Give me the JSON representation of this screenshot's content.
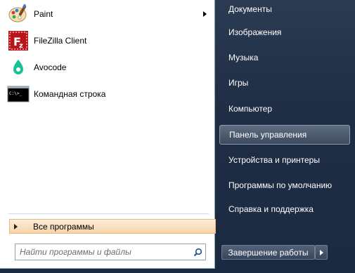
{
  "programs": [
    {
      "label": "Paint",
      "icon": "paint-palette-icon",
      "has_submenu": true
    },
    {
      "label": "FileZilla Client",
      "icon": "filezilla-icon",
      "has_submenu": false
    },
    {
      "label": "Avocode",
      "icon": "avocode-icon",
      "has_submenu": false
    },
    {
      "label": "Командная строка",
      "icon": "command-prompt-icon",
      "has_submenu": false
    }
  ],
  "all_programs": {
    "label": "Все программы"
  },
  "search": {
    "placeholder": "Найти программы и файлы"
  },
  "right_items": [
    {
      "label": "Документы",
      "highlighted": false
    },
    {
      "label": "Изображения",
      "highlighted": false
    },
    {
      "label": "Музыка",
      "highlighted": false
    },
    {
      "label": "Игры",
      "highlighted": false
    },
    {
      "label": "Компьютер",
      "highlighted": false
    },
    {
      "label": "Панель управления",
      "highlighted": true
    },
    {
      "label": "Устройства и принтеры",
      "highlighted": false
    },
    {
      "label": "Программы по умолчанию",
      "highlighted": false
    },
    {
      "label": "Справка и поддержка",
      "highlighted": false
    }
  ],
  "shutdown": {
    "label": "Завершение работы"
  },
  "colors": {
    "panel_dark": "#1f2e44",
    "all_programs_bg": "#f6d3a8",
    "filezilla_red": "#b8151b",
    "avocode_teal": "#1dbf98"
  }
}
